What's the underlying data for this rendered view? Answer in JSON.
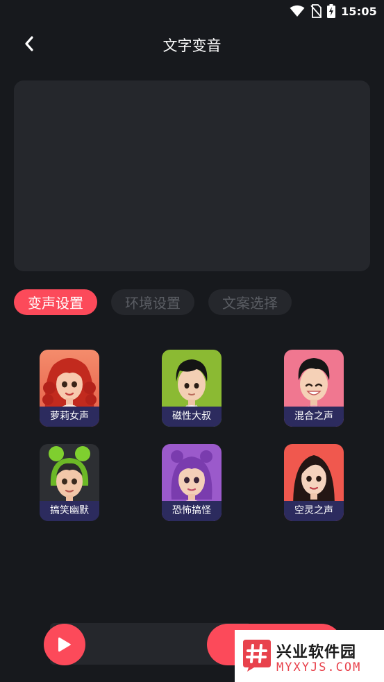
{
  "status_bar": {
    "time": "15:05"
  },
  "header": {
    "title": "文字变音"
  },
  "text_input": {
    "value": "",
    "placeholder": ""
  },
  "tabs": [
    {
      "label": "变声设置",
      "active": true
    },
    {
      "label": "环境设置",
      "active": false
    },
    {
      "label": "文案选择",
      "active": false
    }
  ],
  "voices": [
    {
      "label": "萝莉女声",
      "avatar": "red-curly-hair-girl-avatar"
    },
    {
      "label": "磁性大叔",
      "avatar": "boy-green-background-avatar"
    },
    {
      "label": "混合之声",
      "avatar": "smiling-boy-pink-background-avatar"
    },
    {
      "label": "搞笑幽默",
      "avatar": "green-buns-girl-avatar"
    },
    {
      "label": "恐怖搞怪",
      "avatar": "purple-hair-girl-avatar"
    },
    {
      "label": "空灵之声",
      "avatar": "long-dark-hair-woman-avatar"
    }
  ],
  "watermark": {
    "title": "兴业软件园",
    "url": "MYXYJS.COM"
  },
  "colors": {
    "accent": "#fc4a5a",
    "background": "#17191d",
    "panel": "#25272c",
    "label_bg": "#2c2b5e"
  }
}
